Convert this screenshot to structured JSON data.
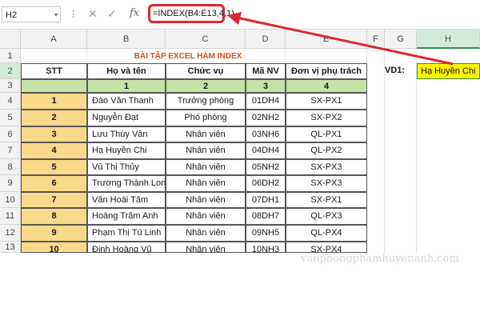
{
  "formula_bar": {
    "name_box": "H2",
    "name_box_arrow": "▾",
    "dots": "⋮",
    "cancel_icon": "✕",
    "enter_icon": "✓",
    "fx_label": "fx",
    "formula": "=INDEX(B4:E13,4,1)"
  },
  "columns": [
    "A",
    "B",
    "C",
    "D",
    "E",
    "F",
    "G",
    "H"
  ],
  "selected_column": "H",
  "rows": [
    "1",
    "2",
    "3",
    "4",
    "5",
    "6",
    "7",
    "8",
    "9",
    "10",
    "11",
    "12",
    "13"
  ],
  "selected_row": "2",
  "sheet": {
    "title": "BÀI TẬP EXCEL HÀM INDEX",
    "headers": [
      "STT",
      "Họ và tên",
      "Chức vụ",
      "Mã NV",
      "Đơn vị phụ trách"
    ],
    "index_numbers": [
      "1",
      "2",
      "3",
      "4"
    ],
    "table": [
      [
        "1",
        "Đào Văn Thanh",
        "Trưởng phòng",
        "01DH4",
        "SX-PX1"
      ],
      [
        "2",
        "Nguyễn Đạt",
        "Phó phòng",
        "02NH2",
        "SX-PX2"
      ],
      [
        "3",
        "Lưu Thùy Vân",
        "Nhân viên",
        "03NH6",
        "QL-PX1"
      ],
      [
        "4",
        "Hạ Huyền Chi",
        "Nhân viên",
        "04DH4",
        "QL-PX2"
      ],
      [
        "5",
        "Vũ Thị Thủy",
        "Nhân viên",
        "05NH2",
        "SX-PX3"
      ],
      [
        "6",
        "Trương Thành Long",
        "Nhân viên",
        "06DH2",
        "SX-PX3"
      ],
      [
        "7",
        "Văn Hoài Tâm",
        "Nhân viên",
        "07DH1",
        "SX-PX1"
      ],
      [
        "8",
        "Hoàng Trâm Anh",
        "Nhân viên",
        "08DH7",
        "QL-PX3"
      ],
      [
        "9",
        "Phạm Thị Tú Linh",
        "Nhân viên",
        "09NH5",
        "QL-PX4"
      ],
      [
        "10",
        "Đinh Hoàng Vũ",
        "Nhân viên",
        "10NH3",
        "SX-PX4"
      ]
    ],
    "vd1_label": "VD1:",
    "result_value": "Hạ Huyền Chi"
  },
  "watermark": "vanphongphamhuyenanh.com",
  "colors": {
    "highlight_box": "#e0262e",
    "arrow": "#e0262e",
    "header_green": "#c6e2a6",
    "stt_yellow": "#f9d98a",
    "result_yellow": "#fff200",
    "title_orange": "#d2521c"
  }
}
